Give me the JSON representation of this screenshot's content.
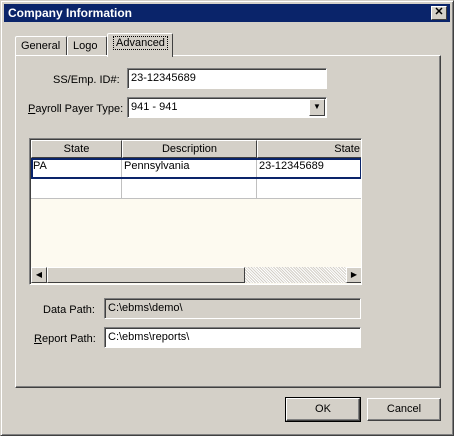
{
  "window": {
    "title": "Company Information",
    "close_glyph": "✕"
  },
  "tabs": [
    {
      "label": "General",
      "active": false
    },
    {
      "label": "Logo",
      "active": false
    },
    {
      "label": "Advanced",
      "active": true
    }
  ],
  "form": {
    "ss_emp_id": {
      "label": "SS/Emp. ID#:",
      "value": "23-12345689"
    },
    "payroll_payer_type": {
      "label_prefix": "P",
      "label_rest": "ayroll Payer Type:",
      "value": "941  - 941"
    },
    "data_path": {
      "label": "Data Path:",
      "value": "C:\\ebms\\demo\\"
    },
    "report_path": {
      "label_prefix": "R",
      "label_rest": "eport Path:",
      "value": "C:\\ebms\\reports\\"
    }
  },
  "grid": {
    "columns": [
      "State",
      "Description",
      "State ID"
    ],
    "rows": [
      [
        "PA",
        "Pennsylvania",
        "23-12345689"
      ],
      [
        "",
        "",
        ""
      ]
    ]
  },
  "buttons": {
    "ok": "OK",
    "cancel": "Cancel"
  },
  "icons": {
    "close": "close-icon",
    "dropdown": "chevron-down-icon",
    "scroll_left": "scroll-left-icon",
    "scroll_right": "scroll-right-icon"
  }
}
